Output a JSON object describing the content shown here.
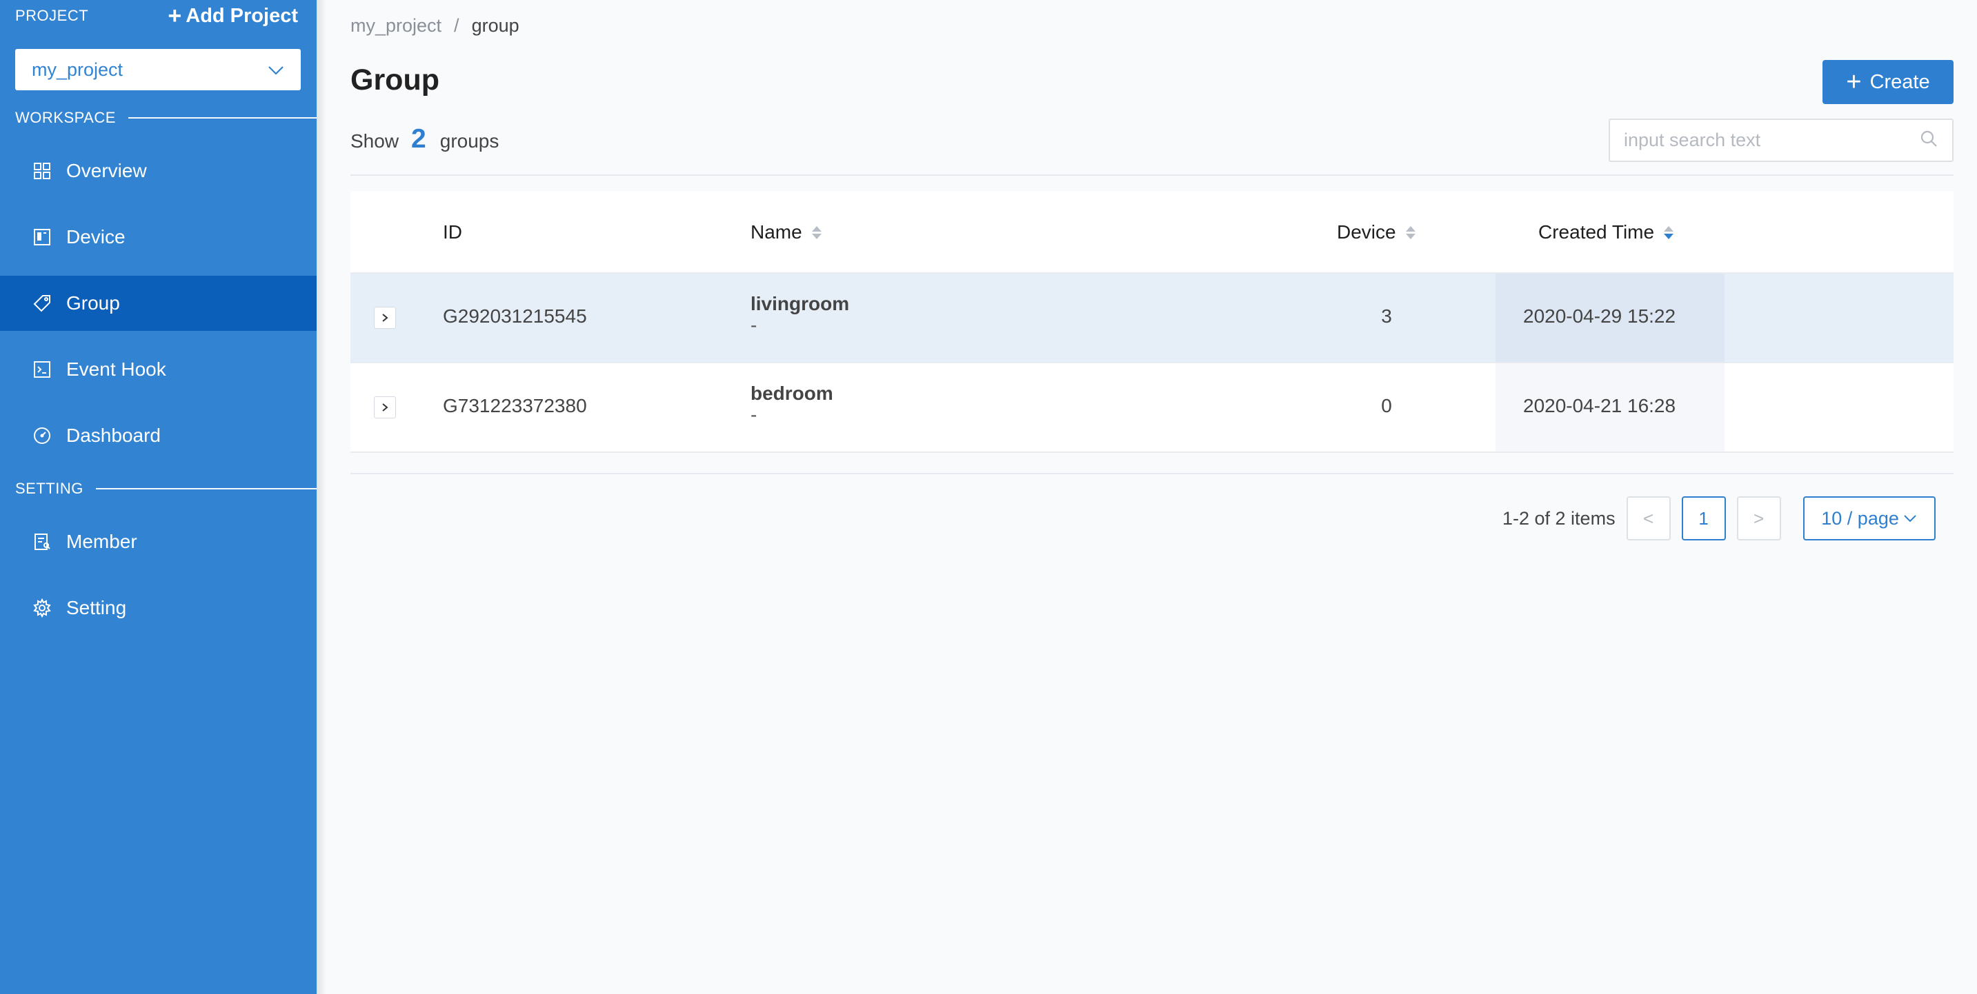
{
  "sidebar": {
    "project_label": "PROJECT",
    "add_project_label": "Add Project",
    "project_selected": "my_project",
    "workspace_label": "WORKSPACE",
    "setting_label": "SETTING",
    "workspace_items": [
      {
        "label": "Overview",
        "icon": "grid-icon"
      },
      {
        "label": "Device",
        "icon": "device-icon"
      },
      {
        "label": "Group",
        "icon": "tag-icon",
        "active": true
      },
      {
        "label": "Event Hook",
        "icon": "terminal-icon"
      },
      {
        "label": "Dashboard",
        "icon": "gauge-icon"
      }
    ],
    "setting_items": [
      {
        "label": "Member",
        "icon": "member-icon"
      },
      {
        "label": "Setting",
        "icon": "gear-icon"
      }
    ],
    "colors": {
      "background": "#3283d2",
      "active": "#0b5fb8"
    }
  },
  "breadcrumb": {
    "parent": "my_project",
    "separator": "/",
    "current": "group"
  },
  "header": {
    "title": "Group",
    "create_label": "Create"
  },
  "summary": {
    "prefix": "Show",
    "count": "2",
    "suffix": "groups"
  },
  "search": {
    "placeholder": "input search text"
  },
  "table": {
    "columns": {
      "id": "ID",
      "name": "Name",
      "device": "Device",
      "created": "Created Time"
    },
    "rows": [
      {
        "id": "G292031215545",
        "name": "livingroom",
        "desc": "-",
        "device": "3",
        "created": "2020-04-29 15:22"
      },
      {
        "id": "G731223372380",
        "name": "bedroom",
        "desc": "-",
        "device": "0",
        "created": "2020-04-21 16:28"
      }
    ]
  },
  "pagination": {
    "total": "1-2 of 2 items",
    "prev": "<",
    "current": "1",
    "next": ">",
    "page_size": "10 / page"
  },
  "accent_color": "#2f7fd0"
}
